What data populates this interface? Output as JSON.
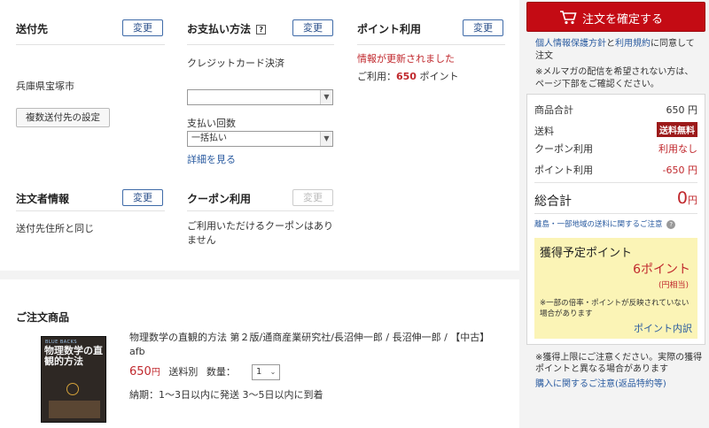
{
  "shipping": {
    "title": "送付先",
    "change": "変更",
    "address": "兵庫県宝塚市",
    "multi_button": "複数送付先の設定"
  },
  "payment": {
    "title": "お支払い方法",
    "help_icon": "question-icon",
    "change": "変更",
    "method": "クレジットカード決済",
    "installments_label": "支払い回数",
    "installments_value": "一括払い",
    "details_link": "詳細を見る"
  },
  "points": {
    "title": "ポイント利用",
    "change": "変更",
    "updated_notice": "情報が更新されました",
    "usage_prefix": "ご利用：",
    "usage_amount": "650",
    "usage_suffix": " ポイント"
  },
  "orderer": {
    "title": "注文者情報",
    "change": "変更",
    "value": "送付先住所と同じ"
  },
  "coupon": {
    "title": "クーポン利用",
    "change": "変更",
    "note": "ご利用いただけるクーポンはありません"
  },
  "items": {
    "title": "ご注文商品",
    "list": [
      {
        "cover_series": "BLUE BACKS",
        "cover_title": "物理数学の直観的方法",
        "name": "物理数学の直観的方法 第２版/通商産業研究社/長沼伸一郎 / 長沼伸一郎 / 【中古】afb",
        "price": "650",
        "price_unit": "円",
        "shipping": "送料別",
        "qty_label": "数量：",
        "qty": "1",
        "delivery": "納期：1～3日以内に発送 3～5日以内に到着"
      }
    ]
  },
  "sidebar": {
    "confirm_button": "注文を確定する",
    "cart_icon": "cart-icon",
    "agree_privacy": "個人情報保護方針",
    "agree_and": "と",
    "agree_terms": "利用規約",
    "agree_suffix": "に同意して注文",
    "mailmag_note": "※メルマガの配信を希望されない方は、ページ下部をご確認ください。",
    "summary": {
      "subtotal_label": "商品合計",
      "subtotal": "650 円",
      "shipping_label": "送料",
      "shipping_badge": "送料無料",
      "coupon_label": "クーポン利用",
      "coupon_value": "利用なし",
      "points_label": "ポイント利用",
      "points_value": "-650 円",
      "total_label": "総合計",
      "total_value": "0",
      "total_unit": "円",
      "remote_link": "離島・一部地域の送料に関するご注意"
    },
    "earn": {
      "title": "獲得予定ポイント",
      "points": "6ポイント",
      "yen_equiv": "(円相当)",
      "note": "※一部の倍率・ポイントが反映されていない場合があります",
      "detail_link": "ポイント内訳"
    },
    "cap_note": "※獲得上限にご注意ください。実際の獲得ポイントと異なる場合があります",
    "purchase_note_link": "購入に関するご注意(返品特約等)"
  },
  "colors": {
    "accent_red": "#c40b14",
    "link_blue": "#2a5ba0",
    "earn_bg": "#fbf4b6"
  }
}
